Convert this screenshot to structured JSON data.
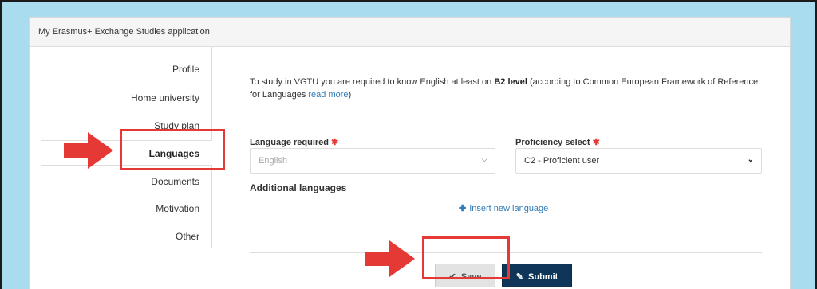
{
  "panel": {
    "title": "My Erasmus+ Exchange Studies application"
  },
  "sidebar": {
    "items": [
      {
        "label": "Profile"
      },
      {
        "label": "Home university"
      },
      {
        "label": "Study plan"
      },
      {
        "label": "Languages"
      },
      {
        "label": "Documents"
      },
      {
        "label": "Motivation"
      },
      {
        "label": "Other"
      }
    ]
  },
  "info": {
    "text_prefix": "To study in VGTU you are required to know English at least on ",
    "level": "B2 level",
    "text_suffix": " (according to Common European Framework of Reference for Languages ",
    "link": "read more",
    "text_end": ")"
  },
  "form": {
    "language_required_label": "Language required",
    "language_required_value": "English",
    "proficiency_label": "Proficiency select",
    "proficiency_value": "C2 - Proficient user",
    "required_mark": "✱"
  },
  "additional": {
    "title": "Additional languages",
    "insert_label": "Insert new language"
  },
  "buttons": {
    "save": "Save",
    "submit": "Submit"
  },
  "colors": {
    "background": "#a9dcef",
    "accent_red": "#e53935",
    "link": "#2f79b7",
    "submit": "#0f3558"
  }
}
